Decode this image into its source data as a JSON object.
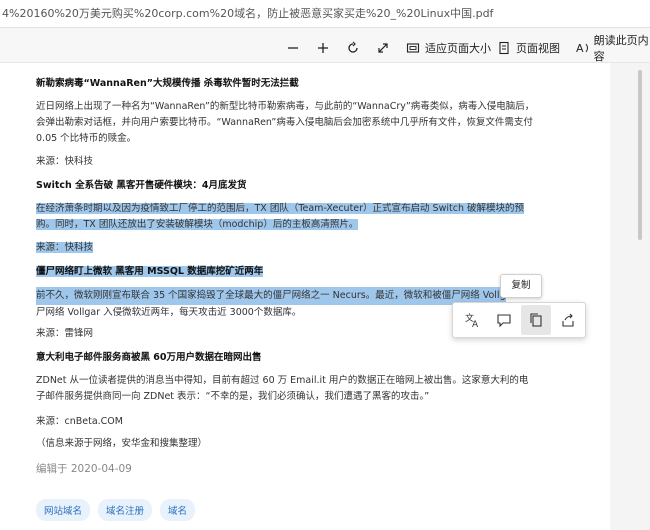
{
  "address_bar": {
    "url": "4%20160%20万美元购买%20corp.com%20域名，防止被恶意买家买走%20_%20Linux中国.pdf"
  },
  "toolbar": {
    "fit_page_label": "适应页面大小",
    "page_view_label": "页面视图",
    "read_aloud_label": "朗读此页内容"
  },
  "document": {
    "articles": [
      {
        "heading": "新勒索病毒“WannaRen”大规模传播 杀毒软件暂时无法拦截",
        "body": "近日网络上出现了一种名为“WannaRen”的新型比特币勒索病毒，与此前的“WannaCry”病毒类似，病毒入侵电脑后，会弹出勒索对话框，并向用户索要比特币。“WannaRen”病毒入侵电脑后会加密系统中几乎所有文件，恢复文件需支付 0.05 个比特币的赎金。",
        "source": "来源：快科技"
      },
      {
        "heading": "Switch 全系告破 黑客开售硬件模块：4月底发货",
        "body": "在经济萧条时期以及因为疫情致工厂停工的范围后，TX 团队（Team-Xecuter）正式宣布启动 Switch 破解模块的预购。同时，TX 团队还放出了安装破解模块（modchip）后的主板高清照片。",
        "source": "来源：快科技"
      },
      {
        "heading": "僵尸网络盯上微软 黑客用 MSSQL 数据库挖矿近两年",
        "body_line1": "前不久，微软刚刚宣布联合 35 个国家捣毁了全球最大的僵尸网络之一 Necurs。最近，微软和被僵尸网络 Vollgar 盯上近两年",
        "body_line2": "尸网络 Vollgar 入侵微软近两年，每天攻击近 3000个数据库。",
        "source": "来源：雷锋网"
      },
      {
        "heading": "意大利电子邮件服务商被黑 60万用户数据在暗网出售",
        "body": "ZDNet 从一位读者提供的消息当中得知，目前有超过 60 万 Email.it 用户的数据正在暗网上被出售。这家意大利的电子邮件服务提供商同一向 ZDNet 表示：“不幸的是，我们必须确认，我们遭遇了黑客的攻击。”",
        "source": "来源：cnBeta.COM"
      }
    ],
    "note": "（信息来源于网络，安华金和搜集整理）",
    "date": "编辑于 2020-04-09",
    "tags": [
      "网站域名",
      "域名注册",
      "域名"
    ]
  },
  "context_menu": {
    "tooltip": "复制"
  },
  "colors": {
    "selection": "#9fc7ec",
    "tag_text": "#2a6fbf",
    "tag_bg": "#e8f2fc"
  }
}
